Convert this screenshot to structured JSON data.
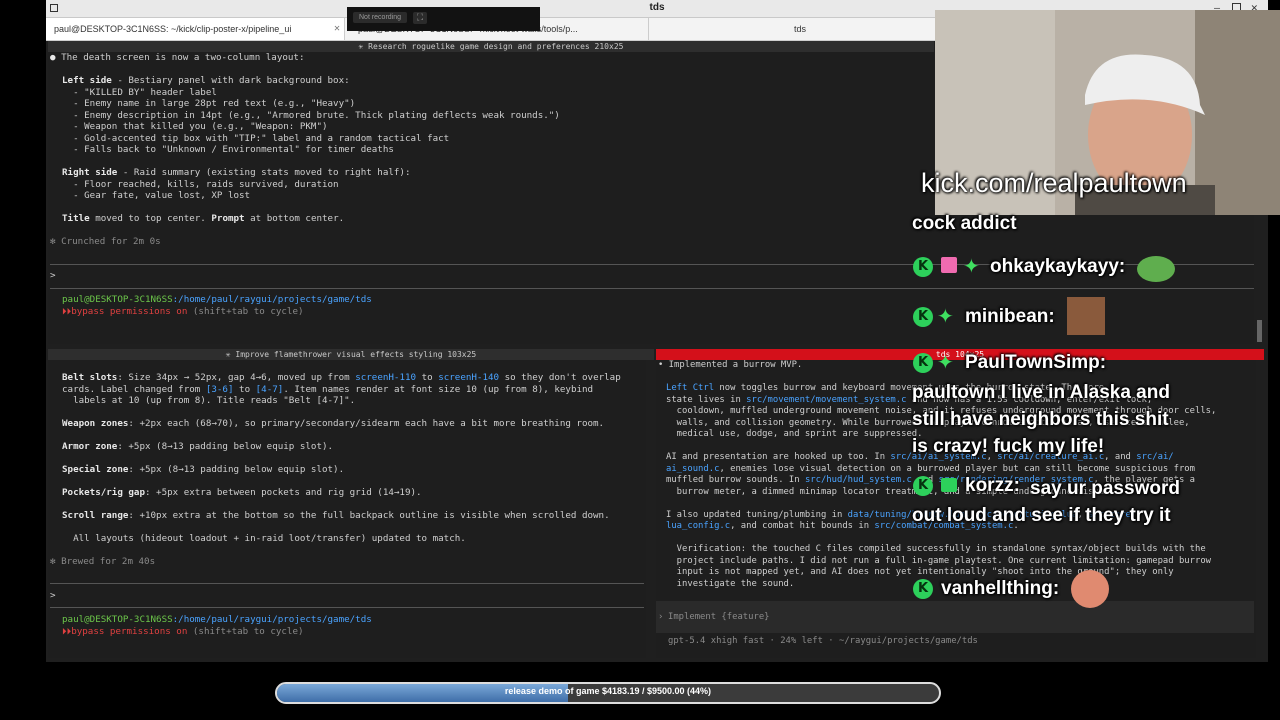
{
  "window": {
    "title": "tds"
  },
  "tabs": [
    {
      "label": "paul@DESKTOP-3C1N6SS: ~/kick/clip-poster-x/pipeline_ui"
    },
    {
      "label": "paul@DESKTOP-3C1N6SS: ~/kick/hoot-wails/tools/p..."
    },
    {
      "label": "tds"
    }
  ],
  "recording": {
    "label": "Not recording",
    "icon": "fullscreen-icon"
  },
  "top_pane": {
    "title": "✳ Research roguelike game design and preferences 210x25",
    "lines": [
      "● The death screen is now a two-column layout:",
      "",
      "  Left side - Bestiary panel with dark background box:",
      "  - \"KILLED BY\" header label",
      "  - Enemy name in large 28pt red text (e.g., \"Heavy\")",
      "  - Enemy description in 14pt (e.g., \"Armored brute. Thick plating deflects weak rounds.\")",
      "  - Weapon that killed you (e.g., \"Weapon: PKM\")",
      "  - Gold-accented tip box with \"TIP:\" label and a random tactical fact",
      "  - Falls back to \"Unknown / Environmental\" for timer deaths",
      "",
      "  Right side - Raid summary (existing stats moved to right half):",
      "  - Floor reached, kills, raids survived, duration",
      "  - Gear fate, value lost, XP lost",
      "",
      "  Title moved to top center. Prompt at bottom center.",
      "",
      "✻ Crunched for 2m 0s"
    ],
    "prompt": ">",
    "path_user": "paul@DESKTOP-3C1N6SS",
    "path_dir": ":/home/paul/raygui/projects/game/tds",
    "bypass": "bypass permissions on",
    "bypass_hint": " (shift+tab to cycle)"
  },
  "left_pane": {
    "title": "✳ Improve flamethrower visual effects styling 103x25",
    "lines": [
      "  Belt slots: Size 34px → 52px, gap 4→6, moved up from screenH-110 to screenH-140 so they don't overlap",
      "  cards. Label changed from [3-6] to [4-7]. Item names render at font size 10 (up from 8), keybind",
      "  labels at 10 (up from 8). Title reads \"Belt [4-7]\".",
      "",
      "  Weapon zones: +2px each (68→70), so primary/secondary/sidearm each have a bit more breathing room.",
      "",
      "  Armor zone: +5px (8→13 padding below equip slot).",
      "",
      "  Special zone: +5px (8→13 padding below equip slot).",
      "",
      "  Pockets/rig gap: +5px extra between pockets and rig grid (14→19).",
      "",
      "  Scroll range: +10px extra at the bottom so the full backpack outline is visible when scrolled down.",
      "",
      "  All layouts (hideout loadout + in-raid loot/transfer) updated to match.",
      "",
      "✻ Brewed for 2m 40s"
    ],
    "prompt": ">",
    "path_user": "paul@DESKTOP-3C1N6SS",
    "path_dir": ":/home/paul/raygui/projects/game/tds",
    "bypass": "bypass permissions on",
    "bypass_hint": " (shift+tab to cycle)"
  },
  "right_pane": {
    "title": "tds 104x25",
    "lines": [
      "• Implemented a burrow MVP.",
      "",
      "  Left Ctrl now toggles burrow and keyboard movement uses the burrow state. The core",
      "  state lives in src/movement/movement_system.c and now has a 1.5s cooldown, enter/exit lock,",
      "  cooldown, muffled underground movement noise, and it refuses underground movement through door cells,",
      "  walls, and collision geometry. While burrowed the player cannot shoot, reload, use items, melee,",
      "  medical use, dodge, and sprint are suppressed.",
      "",
      "  AI and presentation are hooked up too. In src/ai/ai_system.c, src/ai/creature_ai.c, and src/ai/",
      "  ai_sound.c, enemies lose visual detection on a burrowed player but can still become suspicious from",
      "  muffled burrow sounds. In src/hud/hud_system.c and src/rendering/render_system.c, the player gets a",
      "  burrow meter, a dimmed minimap locator treatment, and a simple underground visual.",
      "",
      "  I also updated tuning/plumbing in data/tuning/burrow.lua, src/core/tuning.lua, src/core/",
      "  lua_config.c, and combat hit bounds in src/combat/combat_system.c.",
      "",
      "  Verification: the touched C files compiled successfully in standalone syntax/object builds with the",
      "  project include paths. I did not run a full in-game playtest. One current limitation: gamepad burrow",
      "  input is not mapped yet, and AI does not yet intentionally \"shoot into the ground\"; they only",
      "  investigate the sound."
    ],
    "input_placeholder": "Implement {feature}",
    "status": "gpt-5.4 xhigh fast · 24% left · ~/raygui/projects/game/tds"
  },
  "stream": {
    "url": "kick.com/realpaultown",
    "chat": [
      {
        "user": "",
        "text": "cock addict"
      },
      {
        "user": "ohkaykaykayy:",
        "text": ""
      },
      {
        "user": "minibean:",
        "text": ""
      },
      {
        "user": "PaulTownSimp:",
        "text": "paultown I live in Alaska and still have neighbors this shit is crazy! fuck my life!"
      },
      {
        "user": "korzz:",
        "text": "say ur password out loud and see if they try it"
      },
      {
        "user": "vanhellthing:",
        "text": ""
      }
    ]
  },
  "goal": {
    "text": "release demo of game $4183.19 / $9500.00 (44%)",
    "progress": 0.44
  },
  "colors": {
    "accent_red": "#d4101a",
    "chat_green": "#2dd05b",
    "path_blue": "#4aa3ff"
  }
}
